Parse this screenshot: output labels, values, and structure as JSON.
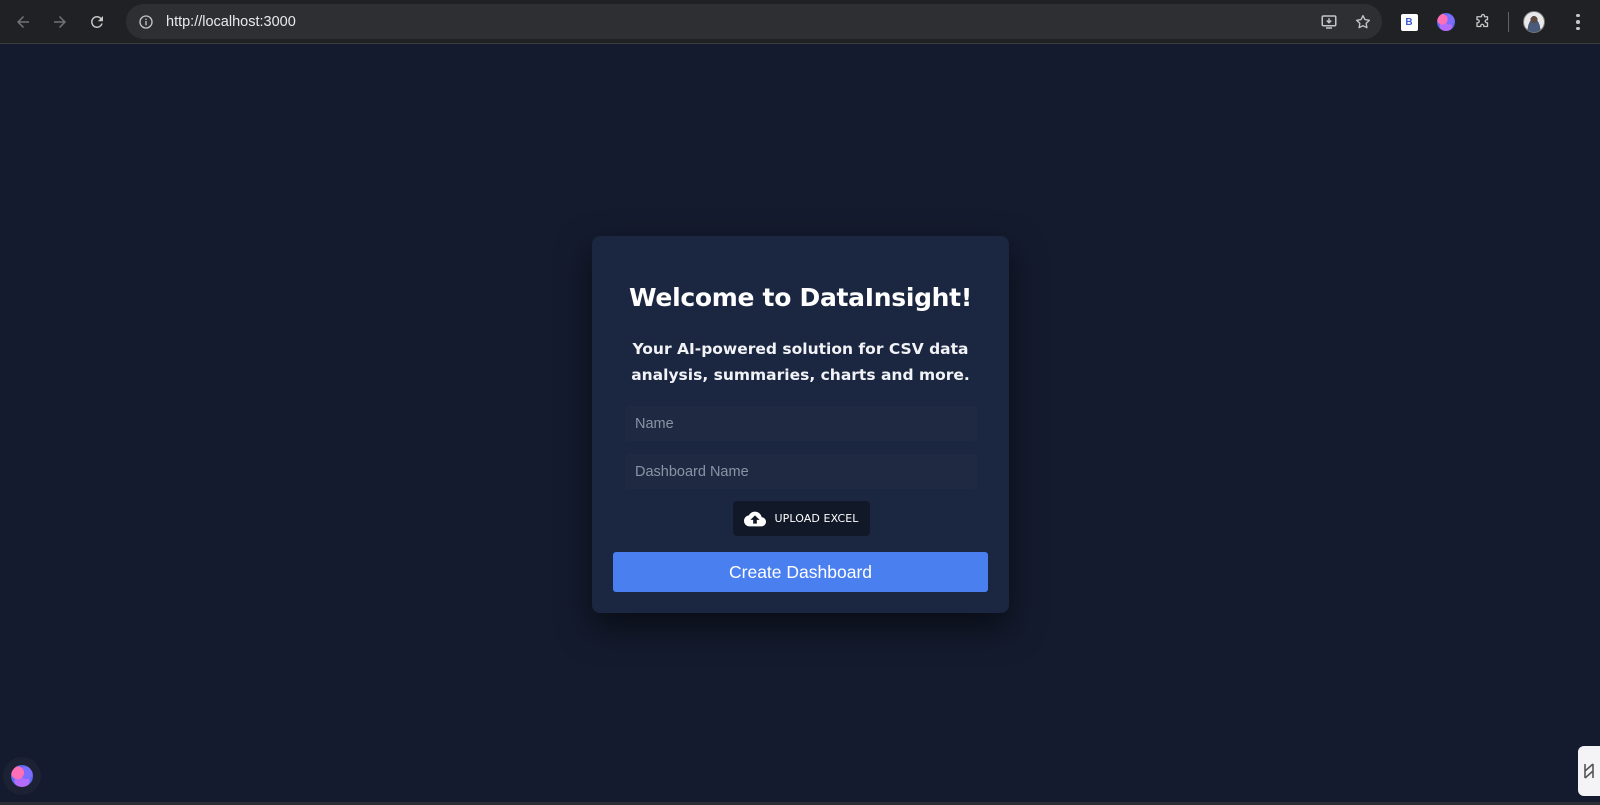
{
  "browser": {
    "url": "http://localhost:3000",
    "nav": {
      "back_icon": "arrow-left-icon",
      "forward_icon": "arrow-right-icon",
      "reload_icon": "reload-icon"
    },
    "site_info_icon": "info-circle-icon",
    "omnibox_actions": [
      "install-app-icon",
      "bookmark-star-icon"
    ],
    "extensions": {
      "b_badge_text": "B",
      "items": [
        "b-extension-icon",
        "brain-extension-icon",
        "puzzle-extensions-icon"
      ]
    },
    "profile_icon": "profile-avatar",
    "menu_icon": "kebab-menu-icon"
  },
  "card": {
    "title": "Welcome to DataInsight!",
    "subtitle": "Your AI-powered solution for CSV data analysis, summaries, charts and more.",
    "name_field": {
      "placeholder": "Name",
      "value": ""
    },
    "dashboard_field": {
      "placeholder": "Dashboard Name",
      "value": ""
    },
    "upload_button": {
      "label": "UPLOAD EXCEL",
      "icon": "cloud-upload-icon"
    },
    "create_button": {
      "label": "Create Dashboard"
    }
  },
  "colors": {
    "page_background": "#141b2e",
    "card_background": "#1b2640",
    "primary_button": "#4a7ff0",
    "upload_button": "#111827"
  }
}
